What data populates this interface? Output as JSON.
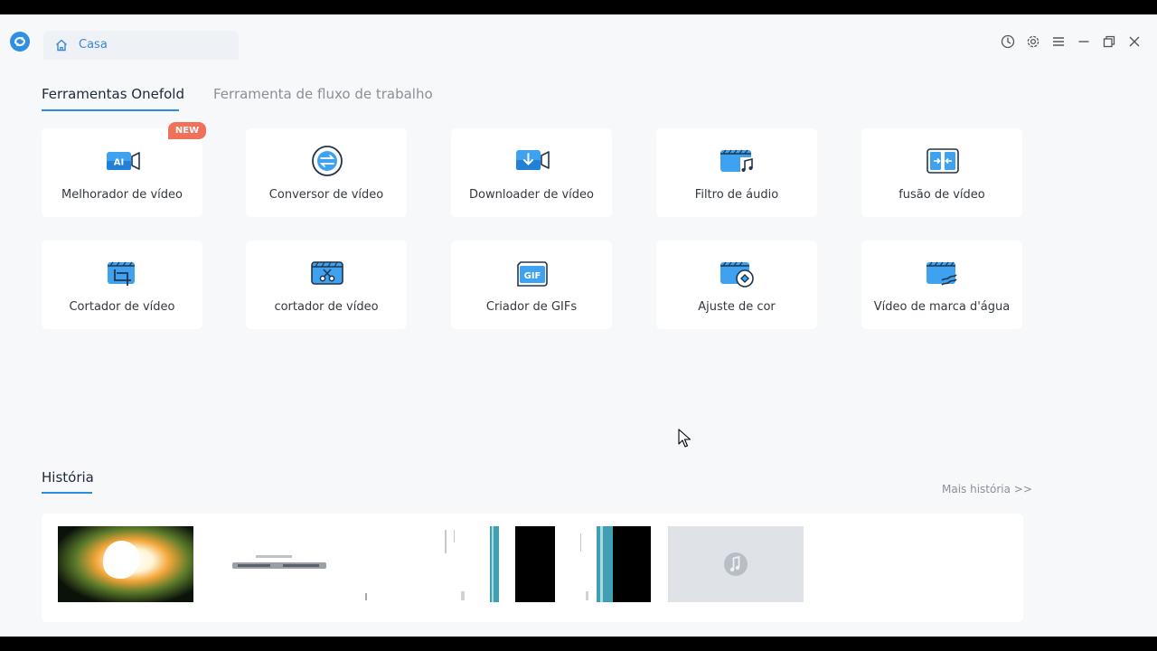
{
  "titlebar": {
    "home_tab_label": "Casa",
    "icons": [
      "history-icon",
      "settings-icon",
      "menu-icon",
      "minimize-icon",
      "restore-icon",
      "close-icon"
    ]
  },
  "tabs": {
    "active": "Ferramentas Onefold",
    "inactive": "Ferramenta de fluxo de trabalho"
  },
  "tools": [
    {
      "label": "Melhorador de vídeo",
      "icon": "ai-video-icon",
      "badge": "NEW"
    },
    {
      "label": "Conversor de vídeo",
      "icon": "convert-icon"
    },
    {
      "label": "Downloader de vídeo",
      "icon": "download-video-icon"
    },
    {
      "label": "Filtro de áudio",
      "icon": "audio-filter-icon"
    },
    {
      "label": "fusão de vídeo",
      "icon": "merge-video-icon"
    },
    {
      "label": "Cortador de vídeo",
      "icon": "crop-video-icon"
    },
    {
      "label": "cortador de vídeo",
      "icon": "cut-video-icon"
    },
    {
      "label": "Criador de GIFs",
      "icon": "gif-icon"
    },
    {
      "label": "Ajuste de cor",
      "icon": "color-adjust-icon"
    },
    {
      "label": "Vídeo de marca d'água",
      "icon": "watermark-icon"
    }
  ],
  "history": {
    "title": "História",
    "more_link": "Mais história >>",
    "items": [
      {
        "kind": "video-frame"
      },
      {
        "kind": "video-frame"
      },
      {
        "kind": "video-frame"
      },
      {
        "kind": "video-frame"
      },
      {
        "kind": "audio-placeholder"
      }
    ]
  },
  "colors": {
    "accent": "#2b8de0",
    "badge": "#f0705a",
    "background": "#f6f8fa"
  }
}
